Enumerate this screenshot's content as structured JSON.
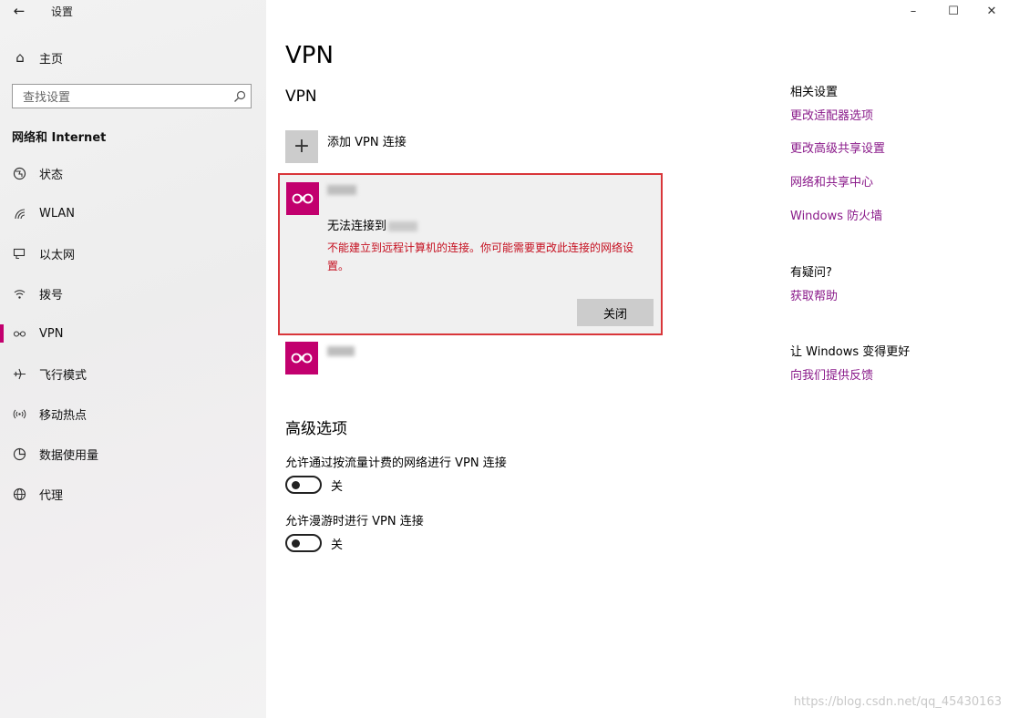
{
  "window": {
    "title": "设置",
    "controls": {
      "minimize": "–",
      "maximize": "☐",
      "close": "✕"
    }
  },
  "sidebar": {
    "home_label": "主页",
    "search_placeholder": "查找设置",
    "section_title": "网络和 Internet",
    "items": [
      {
        "label": "状态",
        "icon": "globe-icon",
        "active": false
      },
      {
        "label": "WLAN",
        "icon": "wifi-icon",
        "active": false
      },
      {
        "label": "以太网",
        "icon": "ethernet-icon",
        "active": false
      },
      {
        "label": "拨号",
        "icon": "dialup-icon",
        "active": false
      },
      {
        "label": "VPN",
        "icon": "vpn-icon",
        "active": true
      },
      {
        "label": "飞行模式",
        "icon": "airplane-icon",
        "active": false
      },
      {
        "label": "移动热点",
        "icon": "hotspot-icon",
        "active": false
      },
      {
        "label": "数据使用量",
        "icon": "data-usage-icon",
        "active": false
      },
      {
        "label": "代理",
        "icon": "proxy-globe-icon",
        "active": false
      }
    ]
  },
  "main": {
    "title": "VPN",
    "vpn_section_title": "VPN",
    "add_vpn_label": "添加 VPN 连接",
    "error_card": {
      "error_title": "无法连接到",
      "error_message": "不能建立到远程计算机的连接。你可能需要更改此连接的网络设置。",
      "close_label": "关闭"
    },
    "advanced": {
      "title": "高级选项",
      "options": [
        {
          "label": "允许通过按流量计费的网络进行 VPN 连接",
          "state": "关",
          "on": false
        },
        {
          "label": "允许漫游时进行 VPN 连接",
          "state": "关",
          "on": false
        }
      ]
    }
  },
  "related": {
    "head": "相关设置",
    "links": [
      "更改适配器选项",
      "更改高级共享设置",
      "网络和共享中心",
      "Windows 防火墙"
    ],
    "help_head": "有疑问?",
    "help_link": "获取帮助",
    "feedback_head": "让 Windows 变得更好",
    "feedback_link": "向我们提供反馈"
  },
  "watermark": "https://blog.csdn.net/qq_45430163",
  "colors": {
    "accent": "#c2006e",
    "error": "#c50f1f",
    "link": "#8a1a8a",
    "card_border": "#d9363a"
  }
}
